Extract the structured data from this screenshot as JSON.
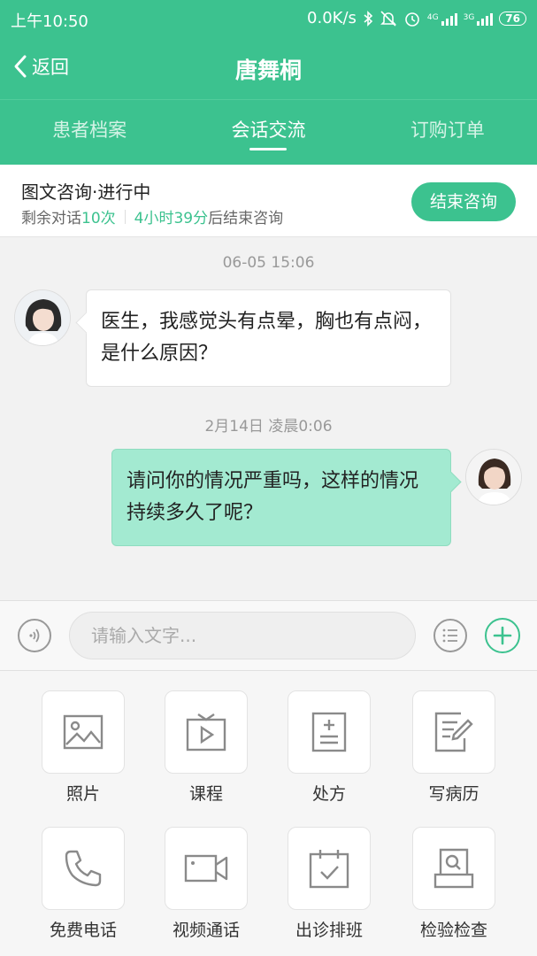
{
  "status_bar": {
    "time": "上午10:50",
    "speed": "0.0K/s",
    "net1": "4G",
    "net2": "3G",
    "battery": "76"
  },
  "header": {
    "back_label": "返回",
    "title": "唐舞桐"
  },
  "tabs": [
    {
      "label": "患者档案"
    },
    {
      "label": "会话交流"
    },
    {
      "label": "订购订单"
    }
  ],
  "consult": {
    "title": "图文咨询·进行中",
    "remaining_prefix": "剩余对话",
    "remaining_count": "10次",
    "time_left": "4小时39分",
    "time_suffix": "后结束咨询",
    "end_label": "结束咨询"
  },
  "messages": [
    {
      "timestamp": "06-05 15:06",
      "text": "医生，我感觉头有点晕，胸也有点闷，是什么原因？"
    },
    {
      "timestamp": "2月14日 凌晨0:06",
      "text": "请问你的情况严重吗，这样的情况持续多久了呢？"
    }
  ],
  "input": {
    "placeholder": "请输入文字..."
  },
  "tools": [
    {
      "label": "照片",
      "icon": "photo-icon"
    },
    {
      "label": "课程",
      "icon": "course-icon"
    },
    {
      "label": "处方",
      "icon": "prescription-icon"
    },
    {
      "label": "写病历",
      "icon": "medical-record-icon"
    },
    {
      "label": "免费电话",
      "icon": "phone-icon"
    },
    {
      "label": "视频通话",
      "icon": "video-call-icon"
    },
    {
      "label": "出诊排班",
      "icon": "calendar-icon"
    },
    {
      "label": "检验检查",
      "icon": "lab-test-icon"
    }
  ],
  "colors": {
    "primary": "#3cc28f",
    "bubble_out": "#a3ead1"
  }
}
